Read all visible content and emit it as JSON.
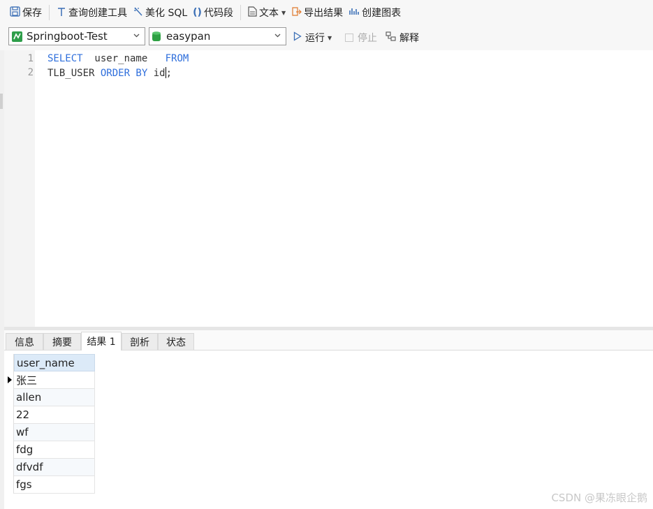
{
  "toolbar": {
    "save": "保存",
    "query_builder": "查询创建工具",
    "beautify_sql": "美化 SQL",
    "code_snippet": "代码段",
    "text": "文本",
    "export_results": "导出结果",
    "create_chart": "创建图表"
  },
  "connection": {
    "selected": "Springboot-Test"
  },
  "database": {
    "selected": "easypan"
  },
  "actions": {
    "run": "运行",
    "stop": "停止",
    "explain": "解释"
  },
  "editor": {
    "line_numbers": [
      "1",
      "2"
    ],
    "line1": {
      "kw1": "SELECT",
      "col": "  user_name   ",
      "kw2": "FROM"
    },
    "line2": {
      "table": "TLB_USER ",
      "kw": "ORDER BY",
      "rest_before_cursor": " id",
      "rest_after_cursor": ";"
    }
  },
  "tabs": [
    "信息",
    "摘要",
    "结果 1",
    "剖析",
    "状态"
  ],
  "active_tab": "结果 1",
  "results": {
    "columns": [
      "user_name"
    ],
    "rows": [
      "张三",
      "allen",
      "22",
      "wf",
      "fdg",
      "dfvdf",
      "fgs"
    ]
  },
  "watermark": "CSDN @果冻眼企鹅",
  "colors": {
    "keyword": "#2f6fdc",
    "header_bg": "#dceaf8",
    "toolbar_bg": "#f7f7f7"
  }
}
